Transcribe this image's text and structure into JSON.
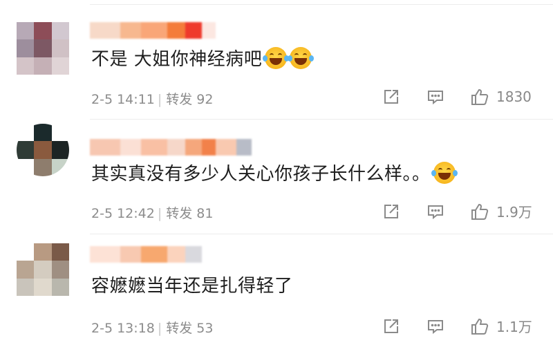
{
  "comments": [
    {
      "text": "不是 大姐你神经病吧",
      "emoji_count": 2,
      "emoji_name": "laughing-tears-icon",
      "date": "2-5 14:11",
      "repost_label": "转发",
      "repost_count": "92",
      "like_count": "1830",
      "avatar_colors": [
        "#b7a9b6",
        "#8d4d58",
        "#d2c8d0",
        "#9d8e9d",
        "#7d5864",
        "#d0c1c5",
        "#d4c4c8",
        "#c5b0b6",
        "#e0d4d6"
      ],
      "name_colors": [
        "#f7d9c8",
        "#f7b88f",
        "#f9a678",
        "#f47c3a",
        "#ef3a2c",
        "#fce7e1"
      ]
    },
    {
      "text": "其实真没有多少人关心你孩子长什么样。。",
      "emoji_count": 1,
      "emoji_name": "crying-tears-icon",
      "date": "2-5 12:42",
      "repost_label": "转发",
      "repost_count": "81",
      "like_count": "1.9万",
      "avatar_colors": [
        "#ffffff",
        "#1b2a2c",
        "#ffffff",
        "#2f3b36",
        "#8a5a3e",
        "#1c2424",
        "#ffffff",
        "#8e7d6d",
        "#c7d3c8"
      ],
      "name_colors": [
        "#f7c7b1",
        "#fbe0d5",
        "#f9c0a4",
        "#f6d7c9",
        "#f5a77c",
        "#f2814a",
        "#f9c9b0",
        "#b8bcc7"
      ]
    },
    {
      "text": "容嬷嬷当年还是扎得轻了",
      "emoji_count": 0,
      "emoji_name": "",
      "date": "2-5 13:18",
      "repost_label": "转发",
      "repost_count": "53",
      "like_count": "1.1万",
      "avatar_colors": [
        "#ffffff",
        "#b89a82",
        "#7a5a48",
        "#b9a592",
        "#d4ccc0",
        "#9f8f82",
        "#c9c4bb",
        "#e0d9cd",
        "#b9b7ad"
      ],
      "name_colors": [
        "#fde2d6",
        "#f8c9b1",
        "#f7a86f",
        "#fbd3bd",
        "#d9d9de"
      ]
    }
  ],
  "icons": {
    "share": "share-icon",
    "comment": "comment-icon",
    "like": "thumbs-up-icon"
  },
  "colors": {
    "text": "#1e1e1e",
    "meta": "#8c8c8c",
    "icon": "#8a8a8a",
    "divider": "#ececec"
  }
}
